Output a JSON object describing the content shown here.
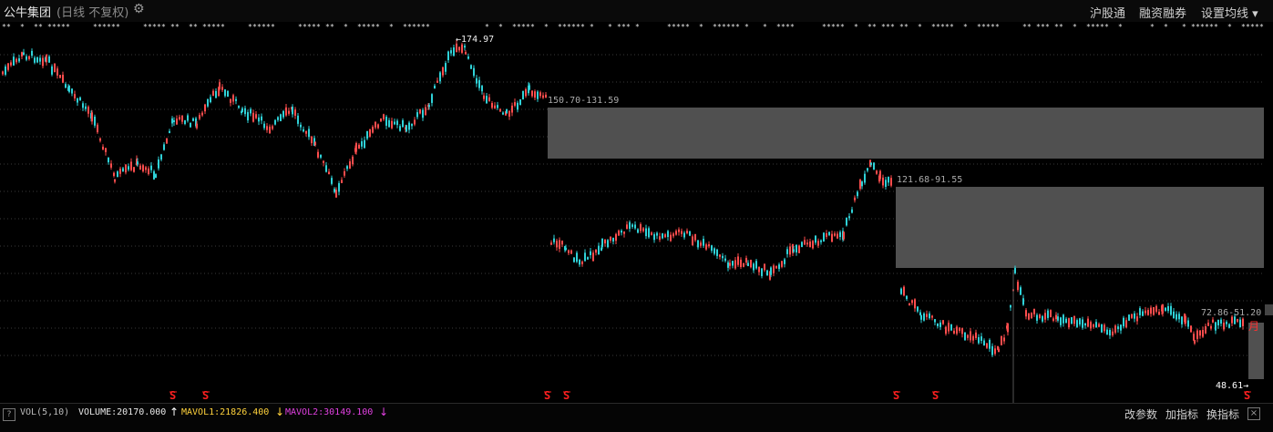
{
  "header": {
    "stock_name": "公牛集团",
    "period_label": "(日线 不复权)",
    "buttons": [
      "沪股通",
      "融资融券",
      "设置均线"
    ]
  },
  "chart": {
    "peak_label": "174.97",
    "low_label": "48.61",
    "zones": [
      {
        "label": "150.70-131.59"
      },
      {
        "label": "121.68-91.55"
      },
      {
        "label": "72.86-51.20"
      }
    ],
    "end_marker": "月",
    "colors": {
      "up": "#ff4d4d",
      "down": "#2fd2d8",
      "zone": "#505050",
      "signal": "#ff2020"
    }
  },
  "volume": {
    "indicator": "VOL(5,10)",
    "volume": "VOLUME:20170.000",
    "mavol1": "MAVOL1:21826.400",
    "mavol2": "MAVOL2:30149.100"
  },
  "footer": {
    "buttons": [
      "改参数",
      "加指标",
      "换指标"
    ],
    "help_icon": "?",
    "close_icon": "×"
  }
}
